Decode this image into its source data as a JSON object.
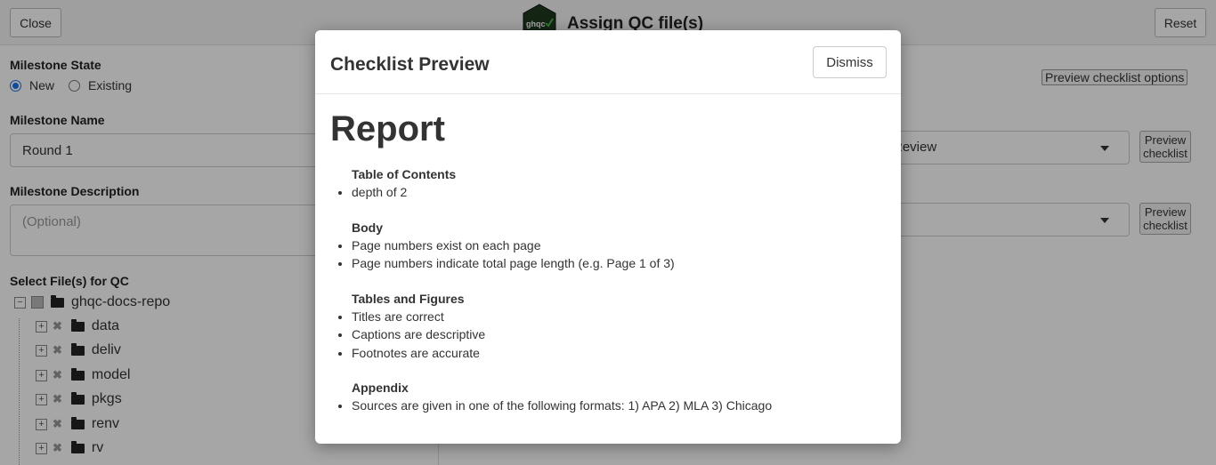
{
  "app": {
    "close_label": "Close",
    "reset_label": "Reset",
    "logo_text": "ghqc",
    "title": "Assign QC file(s)",
    "milestone_state_label": "Milestone State",
    "state_options": [
      "New",
      "Existing"
    ],
    "state_selected": "New",
    "milestone_name_label": "Milestone Name",
    "milestone_name_value": "Round 1",
    "milestone_desc_label": "Milestone Description",
    "milestone_desc_placeholder": "(Optional)",
    "select_files_label": "Select File(s) for QC",
    "tree_root": "ghqc-docs-repo",
    "tree_children": [
      "data",
      "deliv",
      "model",
      "pkgs",
      "renv",
      "rv"
    ],
    "preview_options_label": "Preview checklist options",
    "checklist_select_a": "Review",
    "preview_checklist_label": "Preview checklist"
  },
  "modal": {
    "title": "Checklist Preview",
    "dismiss_label": "Dismiss",
    "report_title": "Report",
    "sections": [
      {
        "heading": "Table of Contents",
        "items": [
          "depth of 2"
        ]
      },
      {
        "heading": "Body",
        "items": [
          "Page numbers exist on each page",
          "Page numbers indicate total page length (e.g. Page 1 of 3)"
        ]
      },
      {
        "heading": "Tables and Figures",
        "items": [
          "Titles are correct",
          "Captions are descriptive",
          "Footnotes are accurate"
        ]
      },
      {
        "heading": "Appendix",
        "items": [
          "Sources are given in one of the following formats: 1) APA 2) MLA 3) Chicago"
        ]
      }
    ]
  },
  "colors": {
    "accent": "#1a73e8",
    "logo_bg": "#1f3a1f",
    "logo_check": "#4caf50"
  }
}
